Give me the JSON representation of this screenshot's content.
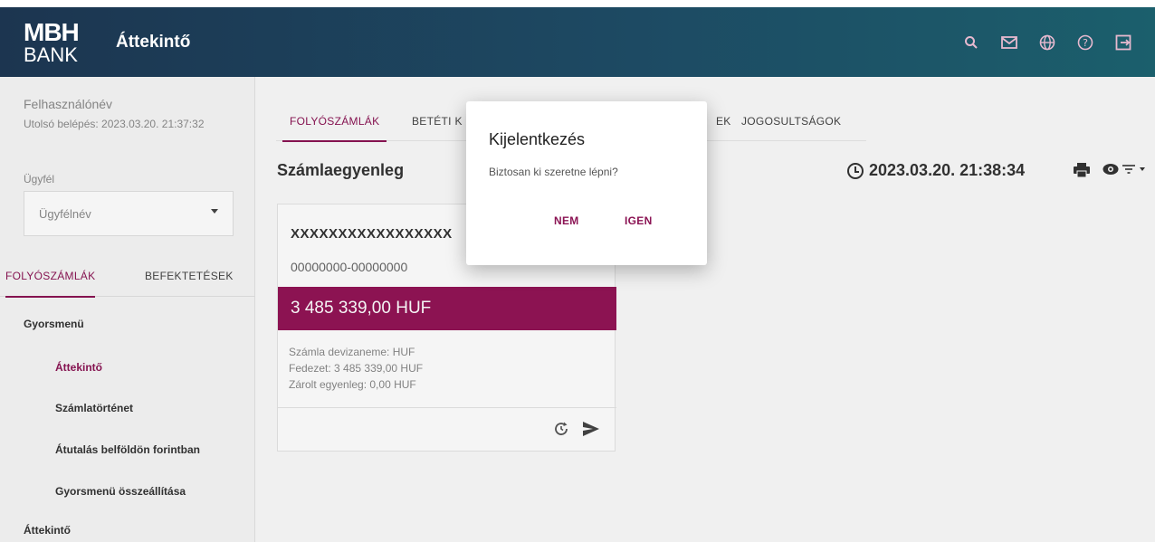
{
  "header": {
    "logo_top": "MBH",
    "logo_bottom": "BANK",
    "title": "Áttekintő",
    "icons": [
      "search-icon",
      "mail-icon",
      "globe-icon",
      "help-icon",
      "logout-icon"
    ]
  },
  "sidebar": {
    "user_name": "Felhasználónév",
    "last_login": "Utolsó belépés: 2023.03.20. 21:37:32",
    "client_label": "Ügyfél",
    "client_value": "Ügyfélnév",
    "tabs": [
      {
        "label": "FOLYÓSZÁMLÁK"
      },
      {
        "label": "BEFEKTETÉSEK"
      }
    ],
    "quickmenu_header": "Gyorsmenü",
    "menu_items": [
      {
        "label": "Áttekintő"
      },
      {
        "label": "Számlatörténet"
      },
      {
        "label": "Átutalás belföldön forintban"
      },
      {
        "label": "Gyorsmenü összeállítása"
      }
    ],
    "bottom_item": "Áttekintő"
  },
  "main": {
    "tabs": [
      {
        "label": "FOLYÓSZÁMLÁK"
      },
      {
        "label": "BETÉTI K"
      },
      {
        "label": "EK"
      },
      {
        "label": "JOGOSULTSÁGOK"
      }
    ],
    "section_title": "Számlaegyenleg",
    "timestamp": "2023.03.20. 21:38:34",
    "account": {
      "name": "XXXXXXXXXXXXXXXXX",
      "number": "00000000-00000000",
      "balance": "3 485 339,00 HUF",
      "details": [
        "Számla devizaneme: HUF",
        "Fedezet: 3 485 339,00 HUF",
        "Zárolt egyenleg: 0,00 HUF"
      ]
    }
  },
  "dialog": {
    "title": "Kijelentkezés",
    "message": "Biztosan ki szeretne lépni?",
    "no_label": "NEM",
    "yes_label": "IGEN"
  },
  "colors": {
    "accent": "#8b1454",
    "balance_bar": "#921456",
    "header_start": "#1c3550",
    "header_end": "#1b5f6c"
  }
}
